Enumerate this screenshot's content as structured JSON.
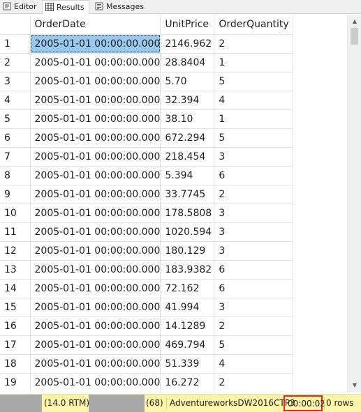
{
  "tabs": [
    {
      "label": "Editor",
      "icon": "editor-icon"
    },
    {
      "label": "Results",
      "icon": "grid-icon"
    },
    {
      "label": "Messages",
      "icon": "messages-icon"
    }
  ],
  "grid": {
    "columns": [
      "OrderDate",
      "UnitPrice",
      "OrderQuantity"
    ],
    "rows": [
      [
        "1",
        "2005-01-01 00:00:00.000",
        "2146.962",
        "2"
      ],
      [
        "2",
        "2005-01-01 00:00:00.000",
        "28.8404",
        "1"
      ],
      [
        "3",
        "2005-01-01 00:00:00.000",
        "5.70",
        "5"
      ],
      [
        "4",
        "2005-01-01 00:00:00.000",
        "32.394",
        "4"
      ],
      [
        "5",
        "2005-01-01 00:00:00.000",
        "38.10",
        "1"
      ],
      [
        "6",
        "2005-01-01 00:00:00.000",
        "672.294",
        "5"
      ],
      [
        "7",
        "2005-01-01 00:00:00.000",
        "218.454",
        "3"
      ],
      [
        "8",
        "2005-01-01 00:00:00.000",
        "5.394",
        "6"
      ],
      [
        "9",
        "2005-01-01 00:00:00.000",
        "33.7745",
        "2"
      ],
      [
        "10",
        "2005-01-01 00:00:00.000",
        "178.5808",
        "3"
      ],
      [
        "11",
        "2005-01-01 00:00:00.000",
        "1020.594",
        "3"
      ],
      [
        "12",
        "2005-01-01 00:00:00.000",
        "180.129",
        "3"
      ],
      [
        "13",
        "2005-01-01 00:00:00.000",
        "183.9382",
        "6"
      ],
      [
        "14",
        "2005-01-01 00:00:00.000",
        "72.162",
        "6"
      ],
      [
        "15",
        "2005-01-01 00:00:00.000",
        "41.994",
        "3"
      ],
      [
        "16",
        "2005-01-01 00:00:00.000",
        "14.1289",
        "2"
      ],
      [
        "17",
        "2005-01-01 00:00:00.000",
        "469.794",
        "5"
      ],
      [
        "18",
        "2005-01-01 00:00:00.000",
        "51.339",
        "4"
      ],
      [
        "19",
        "2005-01-01 00:00:00.000",
        "16.272",
        "2"
      ]
    ]
  },
  "status": {
    "version": "(14.0 RTM)",
    "spid": "(68)",
    "database": "AdventureworksDW2016CTP3",
    "elapsed": "00:00:02",
    "rows": "0 rows"
  },
  "colors": {
    "selected_cell": "#99c9ef",
    "status_bar": "#fdf6a8",
    "highlight_box": "#e0282e"
  }
}
